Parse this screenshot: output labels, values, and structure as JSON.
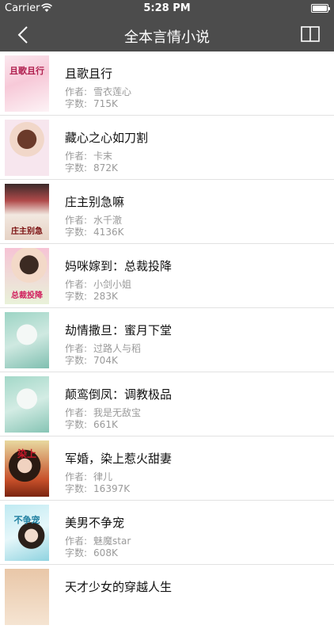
{
  "status_bar": {
    "carrier": "Carrier",
    "time": "5:28 PM"
  },
  "nav": {
    "title": "全本言情小说"
  },
  "labels": {
    "author": "作者:",
    "words": "字数:"
  },
  "books": [
    {
      "title": "且歌且行",
      "author": "雪衣莲心",
      "words": "715K",
      "cover_text": "且歌且行"
    },
    {
      "title": "藏心之心如刀割",
      "author": "卡末",
      "words": "872K",
      "cover_text": ""
    },
    {
      "title": "庄主别急嘛",
      "author": "水千澈",
      "words": "4136K",
      "cover_text": "庄主别急"
    },
    {
      "title": "妈咪嫁到：总裁投降",
      "author": "小剑小姐",
      "words": "283K",
      "cover_text": "总裁投降"
    },
    {
      "title": "劫情撒旦：蜜月下堂",
      "author": "过路人与稻",
      "words": "704K",
      "cover_text": ""
    },
    {
      "title": "颠鸾倒凤：调教极品",
      "author": "我是无敌宝",
      "words": "661K",
      "cover_text": ""
    },
    {
      "title": "军婚，染上惹火甜妻",
      "author": "律儿",
      "words": "16397K",
      "cover_text": "染上"
    },
    {
      "title": "美男不争宠",
      "author": "魅魔star",
      "words": "608K",
      "cover_text": "不争宠"
    },
    {
      "title": "天才少女的穿越人生",
      "author": "",
      "words": "",
      "cover_text": ""
    }
  ],
  "colors": {
    "bar": "#4c4c4c",
    "divider": "#e2e2e2",
    "meta": "#9a9a9a"
  }
}
